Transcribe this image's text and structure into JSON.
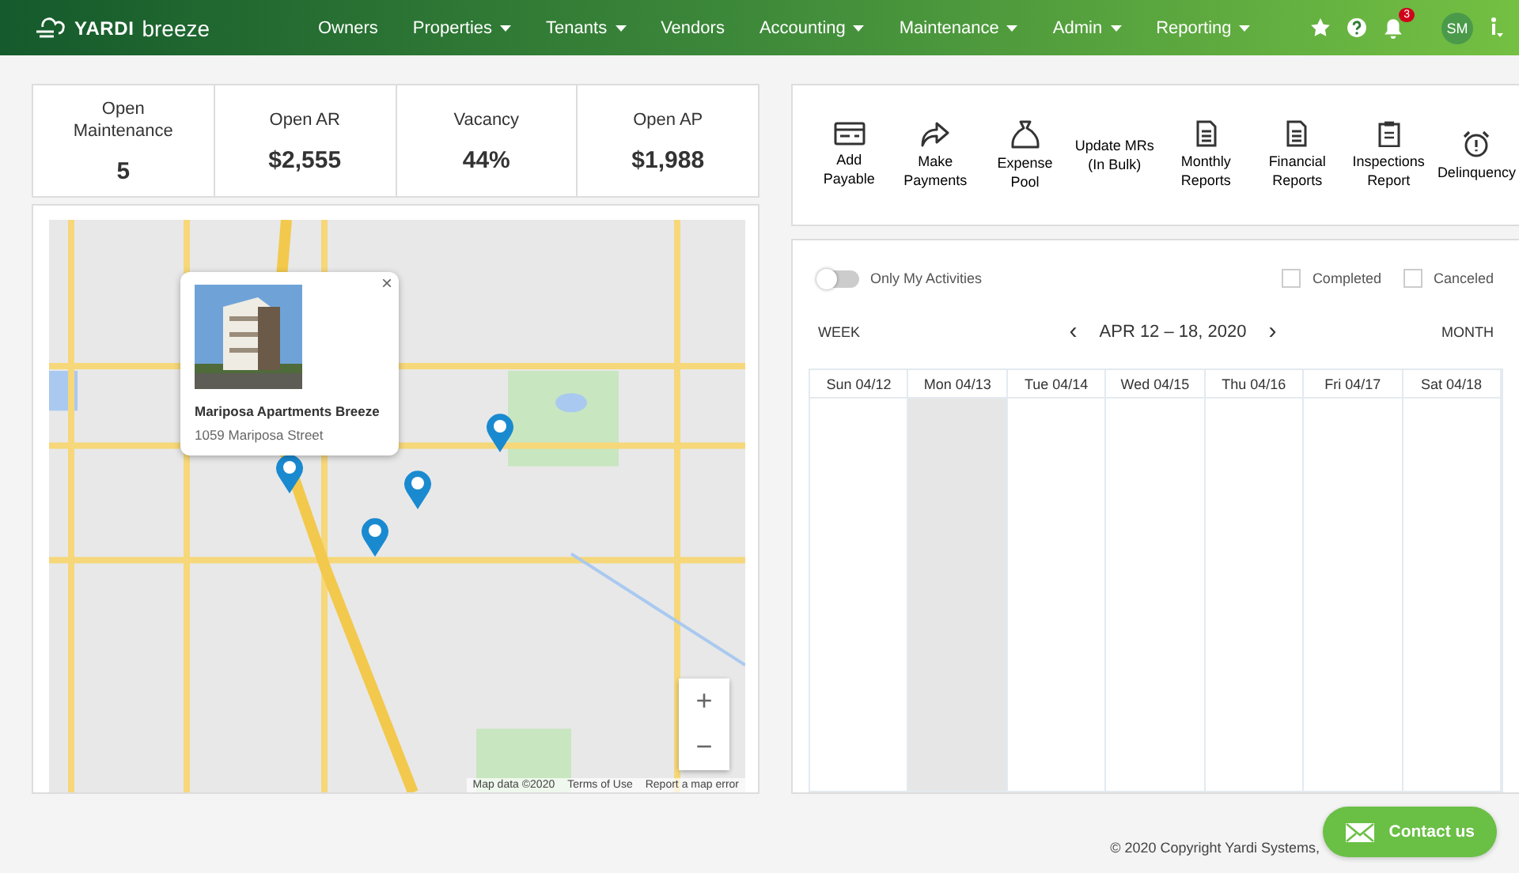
{
  "nav": {
    "logo": {
      "brand": "YARDI",
      "product": "breeze"
    },
    "items": [
      {
        "label": "Owners",
        "dropdown": false
      },
      {
        "label": "Properties",
        "dropdown": true
      },
      {
        "label": "Tenants",
        "dropdown": true
      },
      {
        "label": "Vendors",
        "dropdown": false
      },
      {
        "label": "Accounting",
        "dropdown": true
      },
      {
        "label": "Maintenance",
        "dropdown": true
      },
      {
        "label": "Admin",
        "dropdown": true
      },
      {
        "label": "Reporting",
        "dropdown": true
      }
    ],
    "notifications": "3",
    "user": "SM"
  },
  "stats": [
    {
      "label": "Open Maintenance",
      "value": "5"
    },
    {
      "label": "Open AR",
      "value": "$2,555"
    },
    {
      "label": "Vacancy",
      "value": "44%"
    },
    {
      "label": "Open AP",
      "value": "$1,988"
    }
  ],
  "actions": [
    {
      "label": "Add Payable",
      "kind": "card"
    },
    {
      "label": "Make Payments",
      "kind": "share"
    },
    {
      "label": "Expense Pool",
      "kind": "bag"
    },
    {
      "label": "Update MRs (In Bulk)",
      "kind": "text"
    },
    {
      "label": "Monthly Reports",
      "kind": "document"
    },
    {
      "label": "Financial Reports",
      "kind": "document"
    },
    {
      "label": "Inspections Report",
      "kind": "clipboard"
    },
    {
      "label": "Delinquency",
      "kind": "alarm"
    }
  ],
  "map": {
    "popup": {
      "title": "Mariposa Apartments Breeze",
      "address": "1059 Mariposa Street",
      "close": "×"
    },
    "zoom_in": "+",
    "zoom_out": "−",
    "attribution": [
      "Map data ©2020",
      "Terms of Use",
      "Report a map error"
    ]
  },
  "calendar": {
    "only_my_activities": {
      "label": "Only My Activities",
      "on": false
    },
    "filters": [
      {
        "label": "Completed",
        "checked": false
      },
      {
        "label": "Canceled",
        "checked": false
      }
    ],
    "week_view": "WEEK",
    "range": "APR 12 – 18, 2020",
    "prev": "‹",
    "next": "›",
    "month_view": "MONTH",
    "days": [
      {
        "label": "Sun 04/12",
        "shaded": false
      },
      {
        "label": "Mon 04/13",
        "shaded": true
      },
      {
        "label": "Tue 04/14",
        "shaded": false
      },
      {
        "label": "Wed 04/15",
        "shaded": false
      },
      {
        "label": "Thu 04/16",
        "shaded": false
      },
      {
        "label": "Fri 04/17",
        "shaded": false
      },
      {
        "label": "Sat 04/18",
        "shaded": false
      }
    ]
  },
  "footer": {
    "copyright": "© 2020 Copyright Yardi Systems,",
    "contact": "Contact us"
  }
}
